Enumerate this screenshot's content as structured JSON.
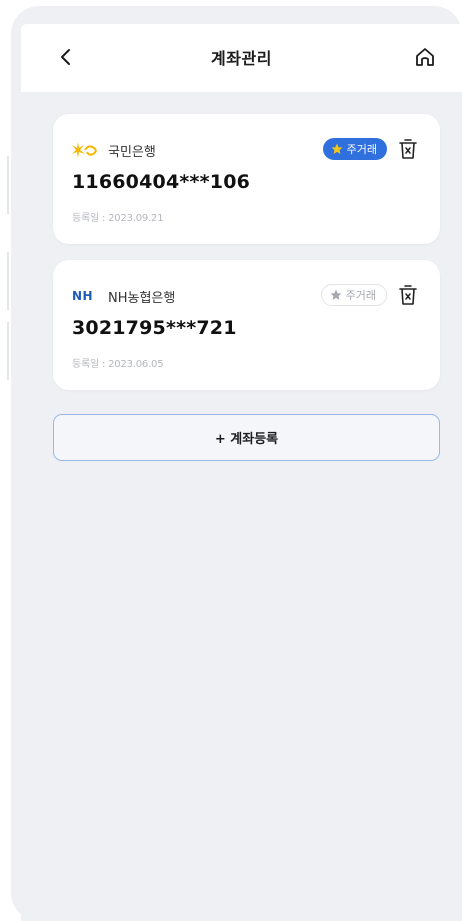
{
  "header": {
    "title": "계좌관리",
    "back_icon": "chevron-left-icon",
    "home_icon": "home-icon"
  },
  "accounts": [
    {
      "bank_name": "국민은행",
      "bank_logo": "kb-star-logo",
      "account_number": "11660404***106",
      "registered": "등록일 : 2023.09.21",
      "main_label": "주거래",
      "is_main": true
    },
    {
      "bank_name": "NH농협은행",
      "bank_logo_text": "NH",
      "account_number": "3021795***721",
      "registered": "등록일 : 2023.06.05",
      "main_label": "주거래",
      "is_main": false
    }
  ],
  "add_button": {
    "label": "+  계좌등록"
  },
  "colors": {
    "accent": "#2f6fde",
    "background": "#eef0f3",
    "kb_yellow": "#f5b800",
    "nh_blue": "#1f5bb7"
  }
}
